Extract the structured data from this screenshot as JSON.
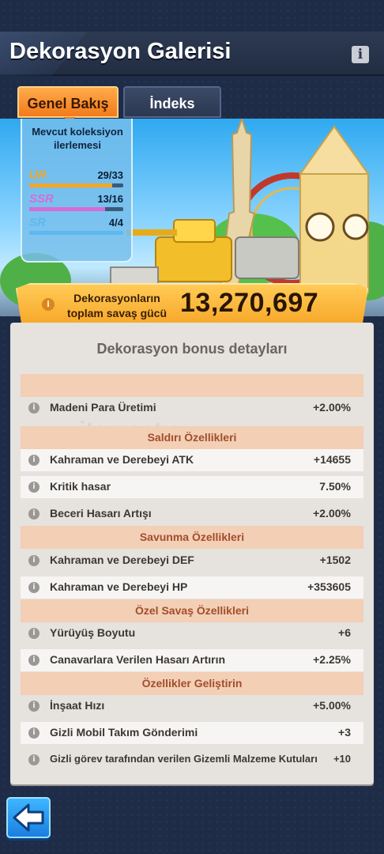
{
  "header": {
    "title": "Dekorasyon Galerisi",
    "info_icon": "info-icon"
  },
  "tabs": [
    {
      "label": "Genel Bakış",
      "active": true
    },
    {
      "label": "İndeks",
      "active": false
    }
  ],
  "collection_progress": {
    "title": "Mevcut koleksiyon ilerlemesi",
    "rows": [
      {
        "rarity": "UR",
        "count": "29/33",
        "progress": 0.88,
        "color": "#f5a623"
      },
      {
        "rarity": "SSR",
        "count": "13/16",
        "progress": 0.81,
        "color": "#d86bd6"
      },
      {
        "rarity": "SR",
        "count": "4/4",
        "progress": 1.0,
        "color": "#5db8f0"
      }
    ]
  },
  "total_power": {
    "label": "Dekorasyonların toplam savaş gücü",
    "value": "13,270,697"
  },
  "details": {
    "title": "Dekorasyon bonus detayları",
    "sections": [
      {
        "header": "",
        "items": [
          {
            "label": "Madeni Para Üretimi",
            "value": "+2.00%"
          }
        ]
      },
      {
        "header": "Saldırı Özellikleri",
        "items": [
          {
            "label": "Kahraman ve Derebeyi ATK",
            "value": "+14655"
          },
          {
            "label": "Kritik hasar",
            "value": "7.50%"
          },
          {
            "label": "Beceri Hasarı Artışı",
            "value": "+2.00%"
          }
        ]
      },
      {
        "header": "Savunma Özellikleri",
        "items": [
          {
            "label": "Kahraman ve Derebeyi DEF",
            "value": "+1502"
          },
          {
            "label": "Kahraman ve Derebeyi HP",
            "value": "+353605"
          }
        ]
      },
      {
        "header": "Özel Savaş Özellikleri",
        "items": [
          {
            "label": "Yürüyüş Boyutu",
            "value": "+6"
          },
          {
            "label": "Canavarlara Verilen Hasarı Artırın",
            "value": "+2.25%"
          }
        ]
      },
      {
        "header": "Özellikler Geliştirin",
        "items": [
          {
            "label": "İnşaat Hızı",
            "value": "+5.00%"
          },
          {
            "label": "Gizli Mobil Takım Gönderimi",
            "value": "+3"
          },
          {
            "label": "Gizli görev tarafından verilen Gizemli Malzeme Kutuları",
            "value": "+10"
          }
        ]
      }
    ]
  },
  "watermark": "itemsatış",
  "back_button": {
    "icon": "back-arrow-icon"
  }
}
